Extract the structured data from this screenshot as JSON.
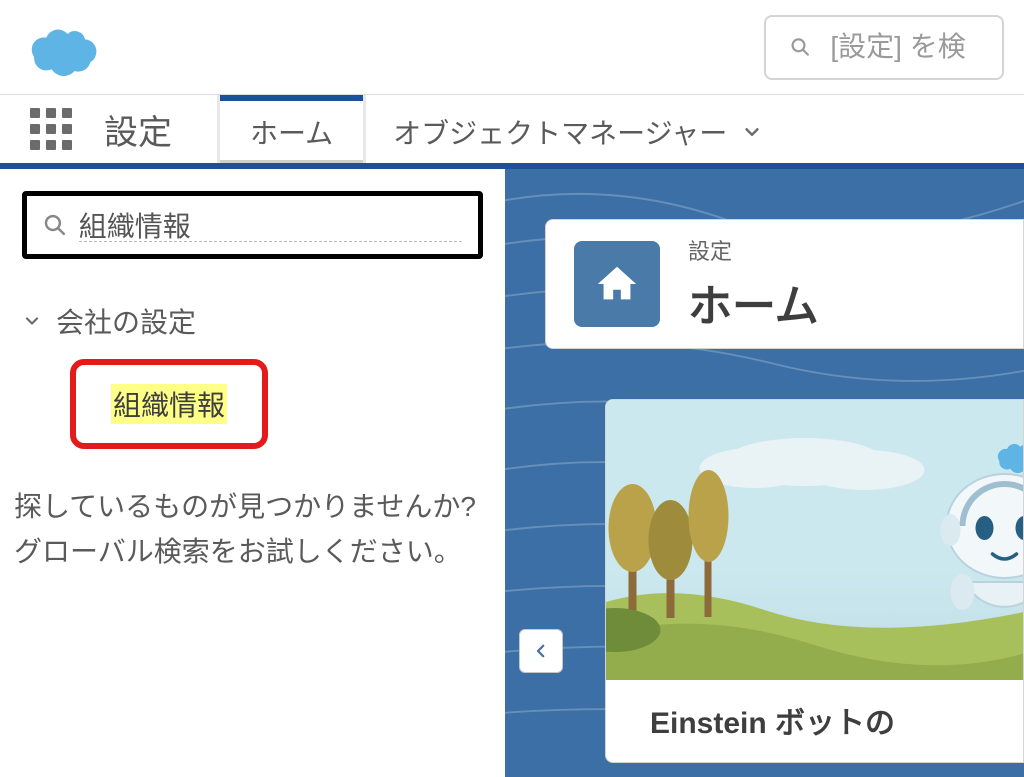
{
  "header": {
    "global_search_placeholder": "[設定] を検"
  },
  "navbar": {
    "title": "設定",
    "tabs": [
      {
        "label": "ホーム",
        "active": true
      },
      {
        "label": "オブジェクトマネージャー",
        "active": false,
        "has_chevron": true
      }
    ]
  },
  "sidebar": {
    "search_value": "組織情報",
    "tree": {
      "section_label": "会社の設定",
      "item_highlighted": "組織情報"
    },
    "help_line1": "探しているものが見つかりませんか?",
    "help_line2": "グローバル検索をお試しください。"
  },
  "main": {
    "page_subtitle": "設定",
    "page_title": "ホーム",
    "promo_title": "Einstein ボットの"
  }
}
